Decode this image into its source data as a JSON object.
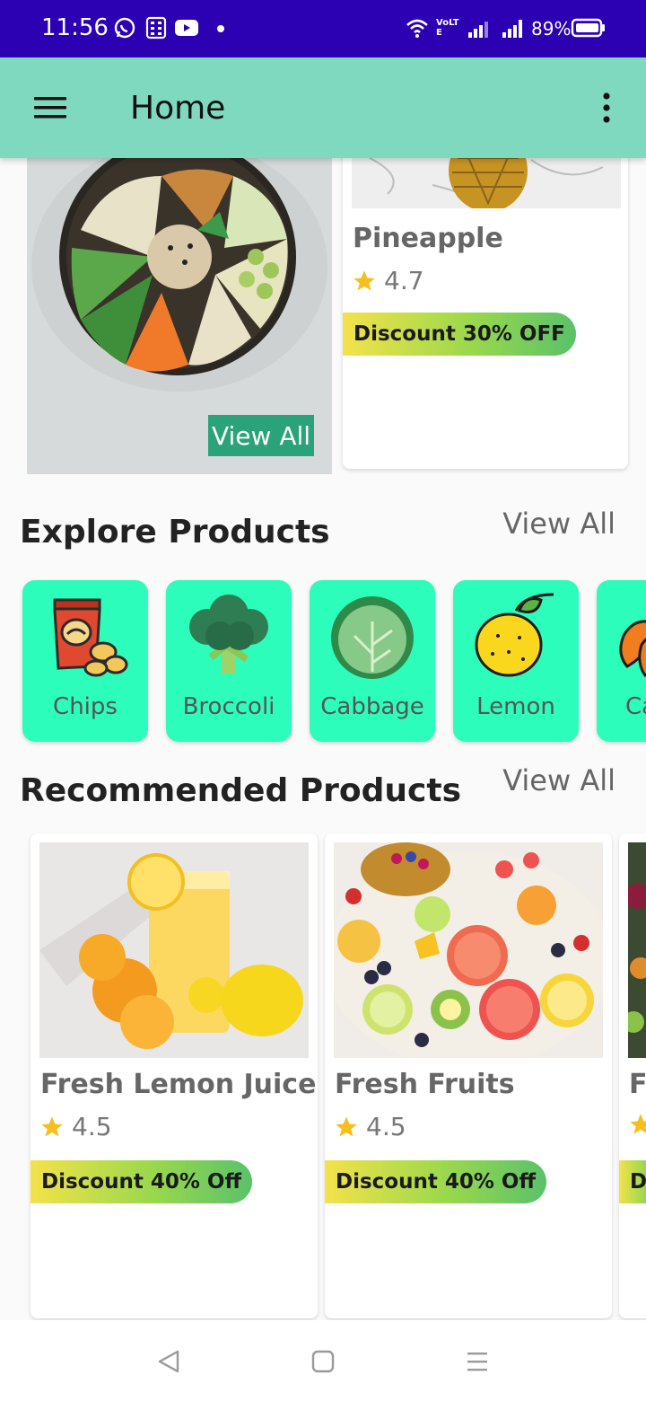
{
  "status_bar": {
    "time": "11:56",
    "battery": "89%",
    "network_label": "VoLTE"
  },
  "app_bar": {
    "title": "Home",
    "menu_icon": "hamburger-menu-icon",
    "more_icon": "more-vert-icon"
  },
  "hero": {
    "view_all_label": "View All"
  },
  "featured": {
    "name": "Pineapple",
    "rating": "4.7",
    "discount": "Discount 30% OFF"
  },
  "explore": {
    "title": "Explore Products",
    "view_all": "View All",
    "categories": [
      {
        "label": "Chips",
        "icon": "chips-icon"
      },
      {
        "label": "Broccoli",
        "icon": "broccoli-icon"
      },
      {
        "label": "Cabbage",
        "icon": "cabbage-icon"
      },
      {
        "label": "Lemon",
        "icon": "lemon-icon"
      },
      {
        "label": "Ca",
        "icon": "carrot-icon"
      }
    ]
  },
  "recommended": {
    "title": "Recommended Products",
    "view_all": "View All",
    "items": [
      {
        "name": "Fresh Lemon Juice",
        "rating": "4.5",
        "discount": "Discount 40% Off"
      },
      {
        "name": "Fresh Fruits",
        "rating": "4.5",
        "discount": "Discount 40% Off"
      },
      {
        "name": "Fr",
        "rating": "",
        "discount": "Di"
      }
    ]
  },
  "colors": {
    "status_bar": "#2c00b3",
    "app_bar": "#7ed9bf",
    "category_tile": "#2dfdbb",
    "view_all_badge": "#2aa27a"
  }
}
